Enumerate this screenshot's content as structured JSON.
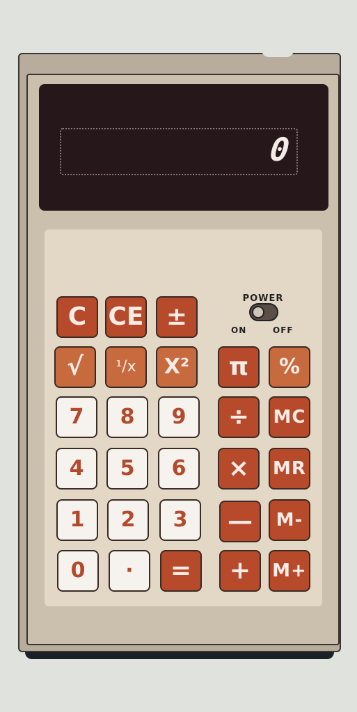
{
  "display": {
    "value": "0"
  },
  "power": {
    "label": "POWER",
    "on_label": "ON",
    "off_label": "OFF",
    "state": "on"
  },
  "keys": {
    "c": "C",
    "ce": "CE",
    "plus_minus": "±",
    "sqrt": "√",
    "reciprocal": "¹/x",
    "square": "X²",
    "pi": "π",
    "percent": "%",
    "seven": "7",
    "eight": "8",
    "nine": "9",
    "divide": "÷",
    "mc": "MC",
    "four": "4",
    "five": "5",
    "six": "6",
    "multiply": "×",
    "mr": "MR",
    "one": "1",
    "two": "2",
    "three": "3",
    "minus": "—",
    "m_minus": "M-",
    "zero": "0",
    "decimal": "·",
    "equals": "=",
    "plus": "+",
    "m_plus": "M+"
  },
  "colors": {
    "body": "#cbbfad",
    "display_bg": "#26171a",
    "key_red": "#b84a2c",
    "key_orange": "#c76a3e",
    "key_white": "#f6f3ee",
    "background": "#e0e2dd"
  }
}
